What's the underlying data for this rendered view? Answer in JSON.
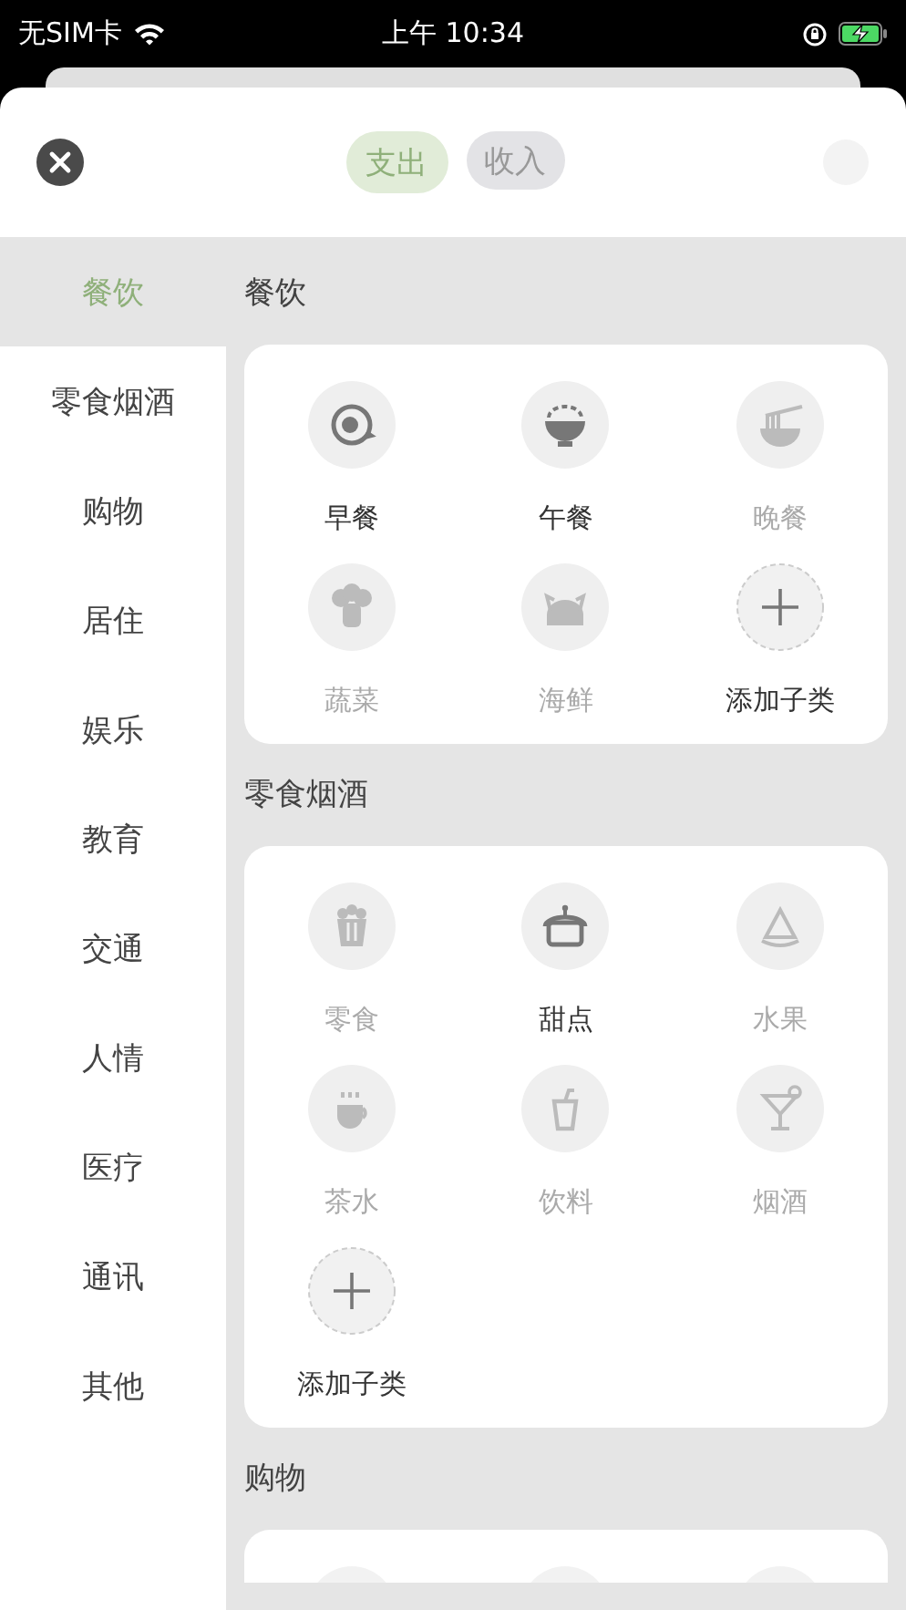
{
  "status_bar": {
    "carrier": "无SIM卡",
    "time": "上午 10:34"
  },
  "header": {
    "tabs": [
      {
        "label": "支出",
        "selected": true
      },
      {
        "label": "收入",
        "selected": false
      }
    ]
  },
  "sidebar": {
    "items": [
      {
        "label": "餐饮",
        "selected": true
      },
      {
        "label": "零食烟酒",
        "selected": false
      },
      {
        "label": "购物",
        "selected": false
      },
      {
        "label": "居住",
        "selected": false
      },
      {
        "label": "娱乐",
        "selected": false
      },
      {
        "label": "教育",
        "selected": false
      },
      {
        "label": "交通",
        "selected": false
      },
      {
        "label": "人情",
        "selected": false
      },
      {
        "label": "医疗",
        "selected": false
      },
      {
        "label": "通讯",
        "selected": false
      },
      {
        "label": "其他",
        "selected": false
      }
    ]
  },
  "sections": [
    {
      "title": "餐饮",
      "items": [
        {
          "kind": "category",
          "label": "早餐",
          "active": true
        },
        {
          "kind": "category",
          "label": "午餐",
          "active": true
        },
        {
          "kind": "category",
          "label": "晚餐",
          "active": false
        },
        {
          "kind": "category",
          "label": "蔬菜",
          "active": false
        },
        {
          "kind": "category",
          "label": "海鲜",
          "active": false
        },
        {
          "kind": "add",
          "label": "添加子类",
          "active": true
        }
      ]
    },
    {
      "title": "零食烟酒",
      "items": [
        {
          "kind": "category",
          "label": "零食",
          "active": false
        },
        {
          "kind": "category",
          "label": "甜点",
          "active": true
        },
        {
          "kind": "category",
          "label": "水果",
          "active": false
        },
        {
          "kind": "category",
          "label": "茶水",
          "active": false
        },
        {
          "kind": "category",
          "label": "饮料",
          "active": false
        },
        {
          "kind": "category",
          "label": "烟酒",
          "active": false
        },
        {
          "kind": "add",
          "label": "添加子类",
          "active": true
        }
      ]
    },
    {
      "title": "购物"
    }
  ]
}
